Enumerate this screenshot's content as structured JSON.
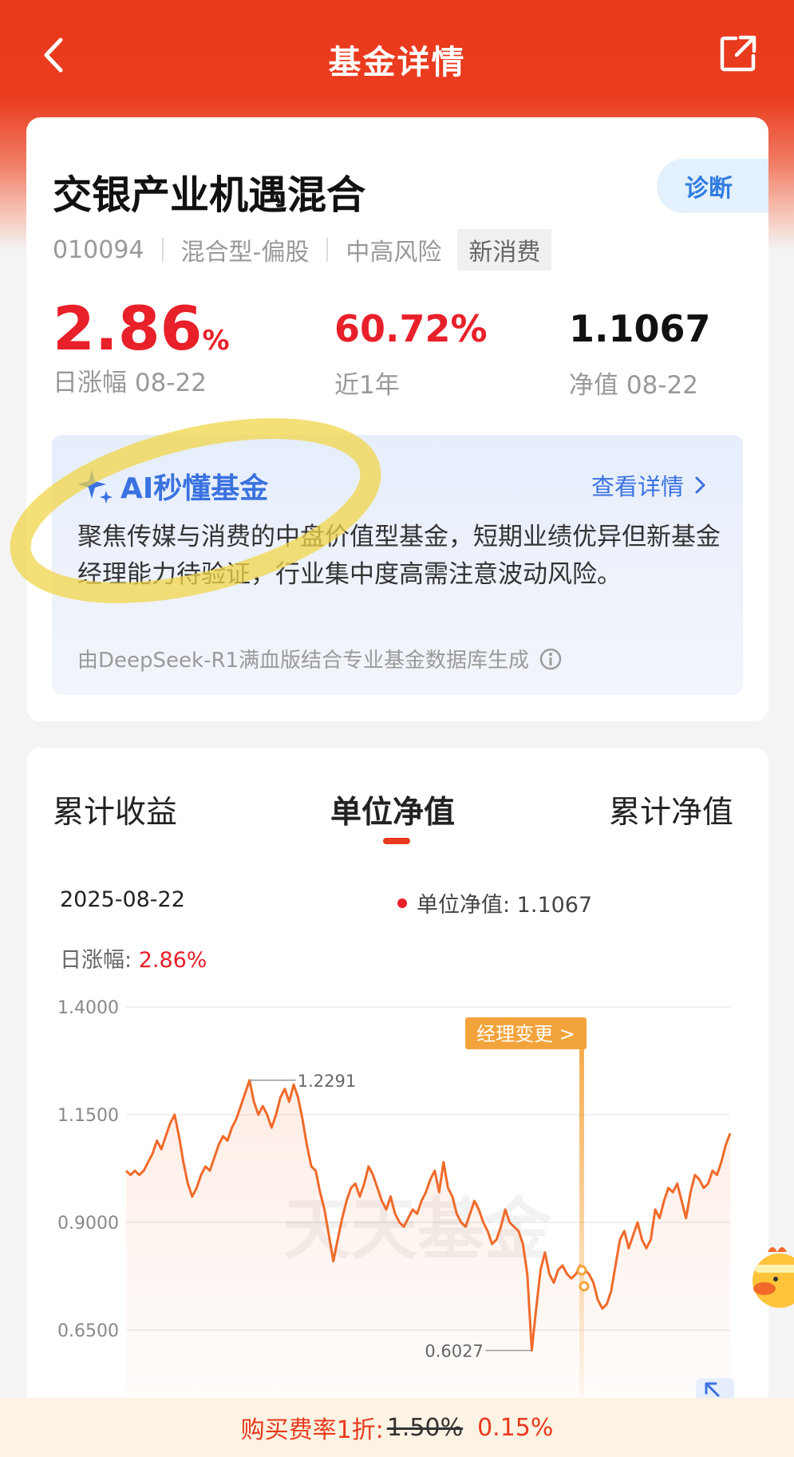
{
  "nav": {
    "title": "基金详情"
  },
  "fund": {
    "name": "交银产业机遇混合",
    "diagnose": "诊断",
    "code": "010094",
    "type": "混合型-偏股",
    "risk": "中高风险",
    "theme": "新消费",
    "daily_change": "2.86",
    "daily_change_unit": "%",
    "daily_change_label": "日涨幅 08-22",
    "year_return": "60.72%",
    "year_return_label": "近1年",
    "nav_value": "1.1067",
    "nav_label": "净值 08-22"
  },
  "ai": {
    "title": "AI秒懂基金",
    "more": "查看详情",
    "summary": "聚焦传媒与消费的中盘价值型基金，短期业绩优异但新基金经理能力待验证，行业集中度高需注意波动风险。",
    "footer": "由DeepSeek-R1满血版结合专业基金数据库生成"
  },
  "chart_tabs": [
    "累计收益",
    "单位净值",
    "累计净值"
  ],
  "chart_info": {
    "date": "2025-08-22",
    "nav_label": "单位净值: 1.1067",
    "change_label": "日涨幅: ",
    "change_value": "2.86%"
  },
  "chart_data": {
    "type": "line",
    "title": "",
    "y_ticks": [
      "1.4000",
      "1.1500",
      "0.9000",
      "0.6500"
    ],
    "ylim": [
      0.6,
      1.4
    ],
    "annotations": {
      "max": "1.2291",
      "min": "0.6027",
      "event": "经理变更 >"
    },
    "watermark": "天天基金",
    "series": [
      {
        "values": [
          1.02,
          1.01,
          1.02,
          1.01,
          1.02,
          1.04,
          1.06,
          1.09,
          1.07,
          1.1,
          1.13,
          1.15,
          1.1,
          1.04,
          0.99,
          0.96,
          0.98,
          1.01,
          1.03,
          1.02,
          1.05,
          1.08,
          1.1,
          1.09,
          1.12,
          1.14,
          1.17,
          1.2,
          1.23,
          1.18,
          1.15,
          1.17,
          1.15,
          1.12,
          1.15,
          1.19,
          1.21,
          1.18,
          1.22,
          1.19,
          1.14,
          1.08,
          1.03,
          1.02,
          0.97,
          0.93,
          0.87,
          0.81,
          0.86,
          0.91,
          0.95,
          0.98,
          0.99,
          0.96,
          0.99,
          1.03,
          1.01,
          0.98,
          0.95,
          0.93,
          0.96,
          0.92,
          0.9,
          0.89,
          0.91,
          0.93,
          0.92,
          0.95,
          0.97,
          1.0,
          1.02,
          0.97,
          1.04,
          0.98,
          0.96,
          0.92,
          0.9,
          0.89,
          0.92,
          0.95,
          0.93,
          0.9,
          0.88,
          0.85,
          0.86,
          0.89,
          0.93,
          0.9,
          0.89,
          0.88,
          0.85,
          0.78,
          0.6027,
          0.7,
          0.79,
          0.83,
          0.78,
          0.76,
          0.79,
          0.8,
          0.78,
          0.77,
          0.78,
          0.8,
          0.79,
          0.78,
          0.76,
          0.72,
          0.7,
          0.71,
          0.74,
          0.8,
          0.86,
          0.88,
          0.84,
          0.87,
          0.9,
          0.86,
          0.84,
          0.86,
          0.93,
          0.91,
          0.95,
          0.98,
          0.97,
          0.99,
          0.95,
          0.91,
          0.97,
          1.01,
          1.0,
          0.98,
          0.99,
          1.02,
          1.01,
          1.04,
          1.08,
          1.1067
        ]
      }
    ]
  },
  "promo": {
    "label": "购买费率1折:",
    "old_rate": "1.50%",
    "new_rate": "0.15%"
  },
  "colors": {
    "brand": "#e8391c",
    "up": "#e8202a",
    "ai": "#3a72e0",
    "line": "#f06a2a",
    "event": "#f3a33b"
  }
}
